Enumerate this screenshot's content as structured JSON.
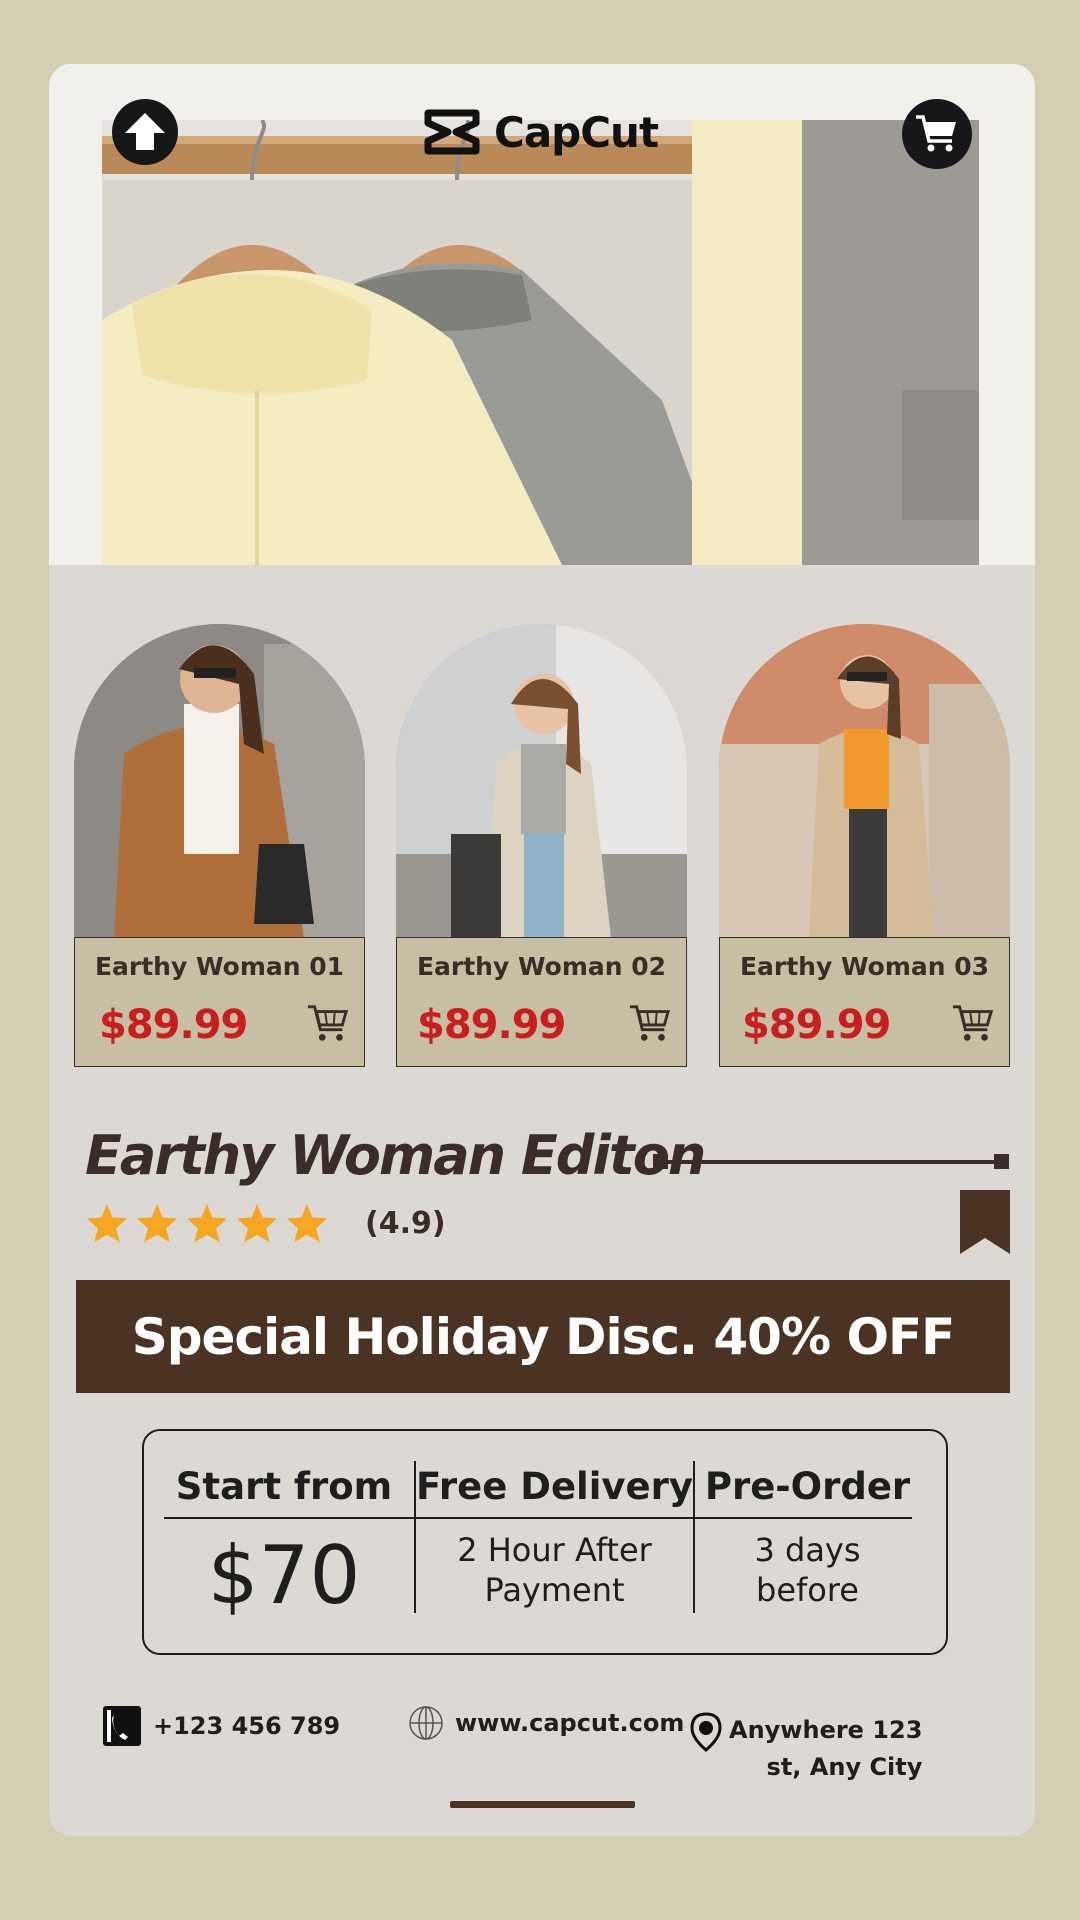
{
  "header": {
    "brand": "CapCut",
    "up_button_icon": "arrow-up-icon",
    "cart_button_icon": "cart-icon"
  },
  "products": [
    {
      "name": "Earthy Woman 01",
      "price": "$89.99"
    },
    {
      "name": "Earthy Woman 02",
      "price": "$89.99"
    },
    {
      "name": "Earthy Woman 03",
      "price": "$89.99"
    }
  ],
  "collection": {
    "title": "Earthy Woman Editon",
    "rating_stars": 5,
    "rating_text": "(4.9)"
  },
  "banner": {
    "text": "Special Holiday Disc. 40% OFF"
  },
  "info": {
    "start_label": "Start from",
    "start_value": "$70",
    "delivery_label": "Free Delivery",
    "delivery_line1": "2 Hour After",
    "delivery_line2": "Payment",
    "preorder_label": "Pre-Order",
    "preorder_line1": "3 days",
    "preorder_line2": "before"
  },
  "contact": {
    "phone": "+123 456 789",
    "website": "www.capcut.com",
    "address_line1": "Anywhere 123",
    "address_line2": "st, Any City"
  },
  "colors": {
    "background": "#d4cfb3",
    "card": "#dcd8d4",
    "dark_brown": "#4a3323",
    "price_red": "#c81e1e",
    "product_info_bg": "#c8bea4",
    "star": "#f5a623"
  }
}
